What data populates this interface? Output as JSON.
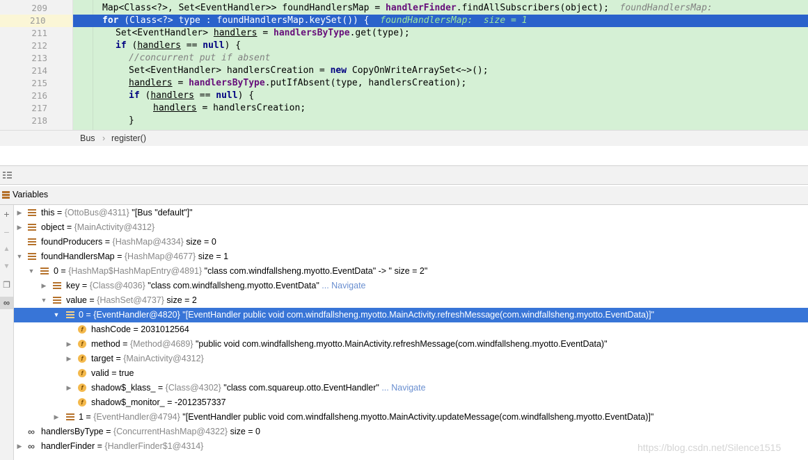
{
  "editor": {
    "lines": [
      {
        "num": "209"
      },
      {
        "num": "210"
      },
      {
        "num": "211"
      },
      {
        "num": "212"
      },
      {
        "num": "213"
      },
      {
        "num": "214"
      },
      {
        "num": "215"
      },
      {
        "num": "216"
      },
      {
        "num": "217"
      },
      {
        "num": "218"
      }
    ],
    "code": {
      "l209_a": "Map<Class<?>, Set<EventHandler>> foundHandlersMap = ",
      "l209_b": "handlerFinder",
      "l209_c": ".findAllSubscribers(object);",
      "l209_hint": "foundHandlersMap:",
      "l210_kw": "for",
      "l210_a": " (Class<?> type : foundHandlersMap.keySet()) {",
      "l210_hint": "foundHandlersMap:  size = 1",
      "l211_a": "Set<EventHandler> ",
      "l211_b": "handlers",
      "l211_c": " = ",
      "l211_d": "handlersByType",
      "l211_e": ".get(type);",
      "l212_kw": "if",
      "l212_a": " (",
      "l212_b": "handlers",
      "l212_c": " == ",
      "l212_null": "null",
      "l212_d": ") {",
      "l213": "//concurrent put if absent",
      "l214_a": "Set<EventHandler> handlersCreation = ",
      "l214_kw": "new",
      "l214_b": " CopyOnWriteArraySet<~>();",
      "l215_a": "handlers",
      "l215_b": " = ",
      "l215_c": "handlersByType",
      "l215_d": ".putIfAbsent(type, handlersCreation);",
      "l216_kw": "if",
      "l216_a": " (",
      "l216_b": "handlers",
      "l216_c": " == ",
      "l216_null": "null",
      "l216_d": ") {",
      "l217_a": "handlers",
      "l217_b": " = handlersCreation;",
      "l218": "}"
    }
  },
  "breadcrumb": {
    "class_name": "Bus",
    "separator": "›",
    "method_name": "register()"
  },
  "variables_panel": {
    "title": "Variables"
  },
  "tree": [
    {
      "name": "this",
      "type": "{OttoBus@4311}",
      "value": "\"[Bus \"default\"]\""
    },
    {
      "name": "object",
      "type": "{MainActivity@4312}",
      "value": ""
    },
    {
      "name": "foundProducers",
      "type": "{HashMap@4334}",
      "value": " size = 0"
    },
    {
      "name": "foundHandlersMap",
      "type": "{HashMap@4677}",
      "value": " size = 1"
    },
    {
      "name": "0",
      "type": "{HashMap$HashMapEntry@4891}",
      "value": "\"class com.windfallsheng.myotto.EventData\" -> \" size = 2\""
    },
    {
      "name": "key",
      "type": "{Class@4036}",
      "value": "\"class com.windfallsheng.myotto.EventData\"",
      "nav": "... Navigate"
    },
    {
      "name": "value",
      "type": "{HashSet@4737}",
      "value": " size = 2"
    },
    {
      "name": "0",
      "type": "{EventHandler@4820}",
      "value": "\"[EventHandler public void com.windfallsheng.myotto.MainActivity.refreshMessage(com.windfallsheng.myotto.EventData)]\""
    },
    {
      "name": "hashCode",
      "type": "",
      "value": "2031012564"
    },
    {
      "name": "method",
      "type": "{Method@4689}",
      "value": "\"public void com.windfallsheng.myotto.MainActivity.refreshMessage(com.windfallsheng.myotto.EventData)\""
    },
    {
      "name": "target",
      "type": "{MainActivity@4312}",
      "value": ""
    },
    {
      "name": "valid",
      "type": "",
      "value": "true"
    },
    {
      "name": "shadow$_klass_",
      "type": "{Class@4302}",
      "value": "\"class com.squareup.otto.EventHandler\"",
      "nav": "... Navigate"
    },
    {
      "name": "shadow$_monitor_",
      "type": "",
      "value": "-2012357337"
    },
    {
      "name": "1",
      "type": "{EventHandler@4794}",
      "value": "\"[EventHandler public void com.windfallsheng.myotto.MainActivity.updateMessage(com.windfallsheng.myotto.EventData)]\""
    },
    {
      "name": "handlersByType",
      "type": "{ConcurrentHashMap@4322}",
      "value": " size = 0"
    },
    {
      "name": "handlerFinder",
      "type": "{HandlerFinder$1@4314}",
      "value": ""
    }
  ],
  "watermark": "https://blog.csdn.net/Silence1515"
}
